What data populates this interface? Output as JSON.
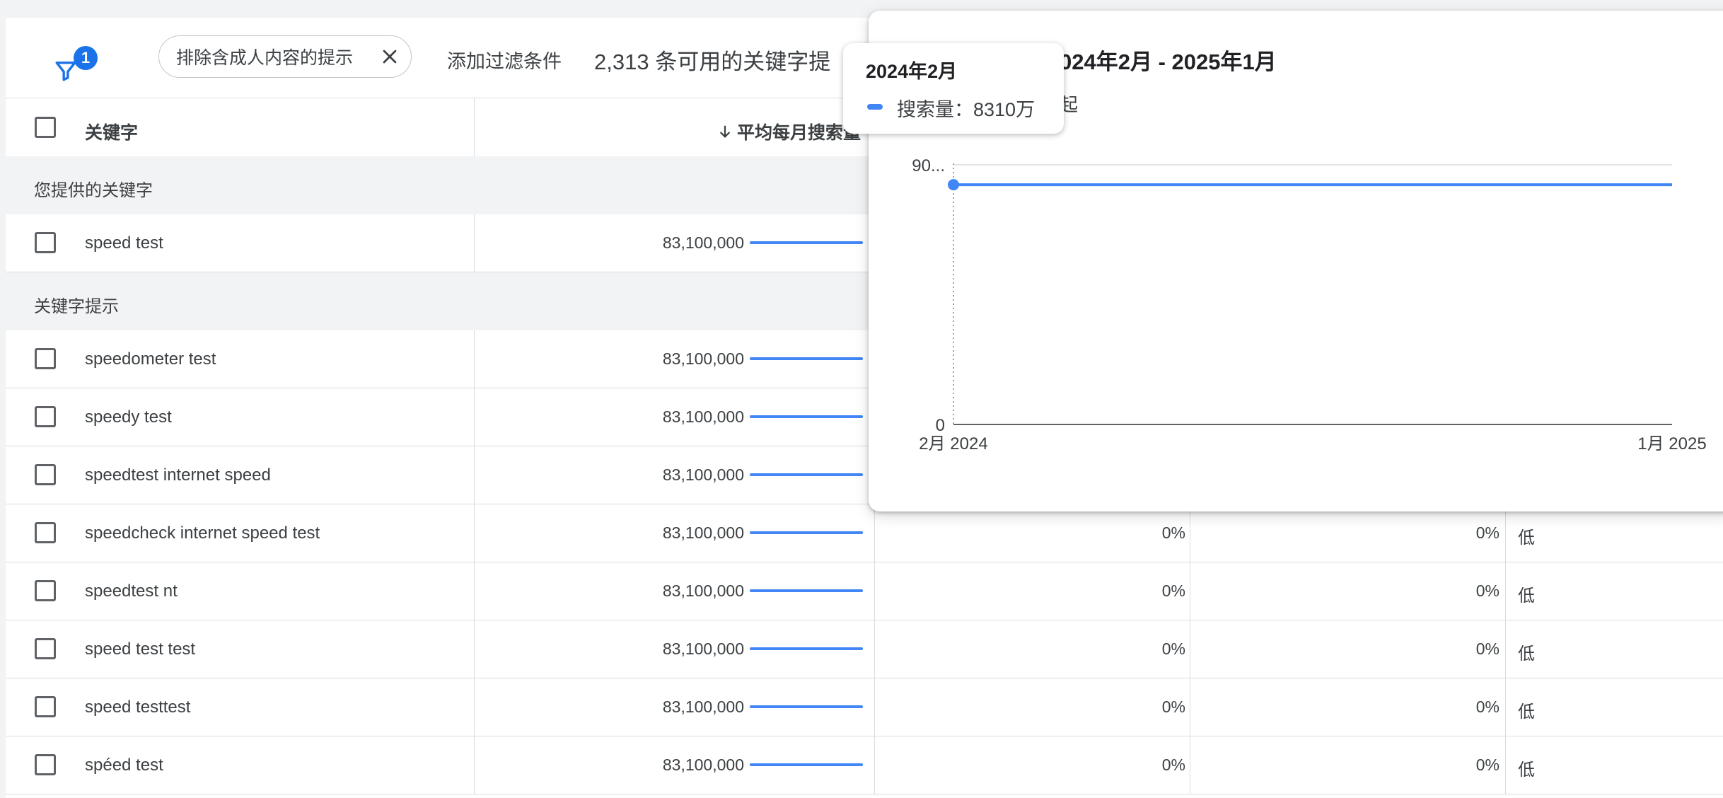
{
  "toolbar": {
    "filter_badge": "1",
    "chip_label": "排除含成人内容的提示",
    "add_filter": "添加过滤条件",
    "keyword_count": "2,313 条可用的关键字提"
  },
  "table": {
    "header_keyword": "关键字",
    "header_volume": "平均每月搜索量",
    "section_provided": "您提供的关键字",
    "section_ideas": "关键字提示",
    "provided_rows": [
      {
        "keyword": "speed test",
        "volume": "83,100,000"
      }
    ],
    "idea_rows": [
      {
        "keyword": "speedometer test",
        "volume": "83,100,000",
        "change_3m": "",
        "change_yoy": "",
        "competition": ""
      },
      {
        "keyword": "speedy test",
        "volume": "83,100,000",
        "change_3m": "",
        "change_yoy": "",
        "competition": ""
      },
      {
        "keyword": "speedtest internet speed",
        "volume": "83,100,000",
        "change_3m": "",
        "change_yoy": "",
        "competition": ""
      },
      {
        "keyword": "speedcheck internet speed test",
        "volume": "83,100,000",
        "change_3m": "0%",
        "change_yoy": "0%",
        "competition": "低"
      },
      {
        "keyword": "speedtest nt",
        "volume": "83,100,000",
        "change_3m": "0%",
        "change_yoy": "0%",
        "competition": "低"
      },
      {
        "keyword": "speed test test",
        "volume": "83,100,000",
        "change_3m": "0%",
        "change_yoy": "0%",
        "competition": "低"
      },
      {
        "keyword": "speed testtest",
        "volume": "83,100,000",
        "change_3m": "0%",
        "change_yoy": "0%",
        "competition": "低"
      },
      {
        "keyword": "spéed test",
        "volume": "83,100,000",
        "change_3m": "0%",
        "change_yoy": "0%",
        "competition": "低"
      }
    ]
  },
  "popup": {
    "title": "024年2月 - 2025年1月",
    "subtitle": "起",
    "tooltip": {
      "title": "2024年2月",
      "series_label": "搜索量：8310万"
    }
  },
  "chart_data": {
    "type": "line",
    "title": "024年2月 - 2025年1月",
    "x_tick_labels": [
      "2月 2024",
      "1月 2025"
    ],
    "y_tick_labels": [
      "90...",
      "0"
    ],
    "ylim": [
      0,
      90000000
    ],
    "x": [
      "2024-02",
      "2024-03",
      "2024-04",
      "2024-05",
      "2024-06",
      "2024-07",
      "2024-08",
      "2024-09",
      "2024-10",
      "2024-11",
      "2024-12",
      "2025-01"
    ],
    "series": [
      {
        "name": "搜索量",
        "values": [
          83100000,
          83100000,
          83100000,
          83100000,
          83100000,
          83100000,
          83100000,
          83100000,
          83100000,
          83100000,
          83100000,
          83100000
        ]
      }
    ],
    "highlighted_point": {
      "x": "2024-02",
      "y": 83100000
    },
    "grid": true,
    "color": "#4285f4"
  }
}
